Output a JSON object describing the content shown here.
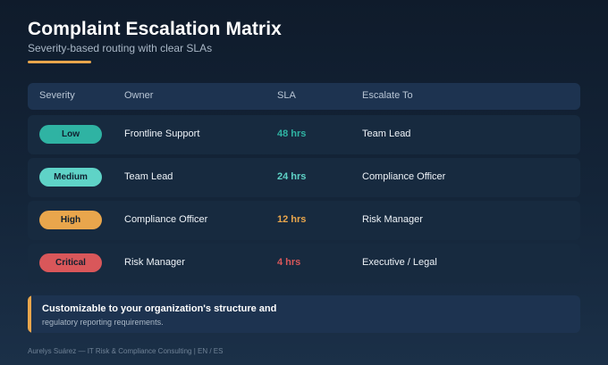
{
  "header": {
    "title": "Complaint Escalation Matrix",
    "subtitle": "Severity-based routing with clear SLAs"
  },
  "table": {
    "columns": [
      "Severity",
      "Owner",
      "SLA",
      "Escalate To"
    ],
    "rows": [
      {
        "severity": "Low",
        "owner": "Frontline Support",
        "sla": "48 hrs",
        "escalate_to": "Team Lead"
      },
      {
        "severity": "Medium",
        "owner": "Team Lead",
        "sla": "24 hrs",
        "escalate_to": "Compliance Officer"
      },
      {
        "severity": "High",
        "owner": "Compliance Officer",
        "sla": "12 hrs",
        "escalate_to": "Risk Manager"
      },
      {
        "severity": "Critical",
        "owner": "Risk Manager",
        "sla": "4 hrs",
        "escalate_to": "Executive / Legal"
      }
    ]
  },
  "colors": {
    "low": "#2fb3a3",
    "medium": "#5fd3c7",
    "high": "#e9a64c",
    "critical": "#d9575a",
    "accent": "#e9a64c"
  },
  "callout": {
    "line1": "Customizable to your organization's structure and",
    "line2": "regulatory reporting requirements."
  },
  "footer": {
    "text": "Aurelys Suárez — IT Risk & Compliance Consulting  |  EN / ES"
  }
}
